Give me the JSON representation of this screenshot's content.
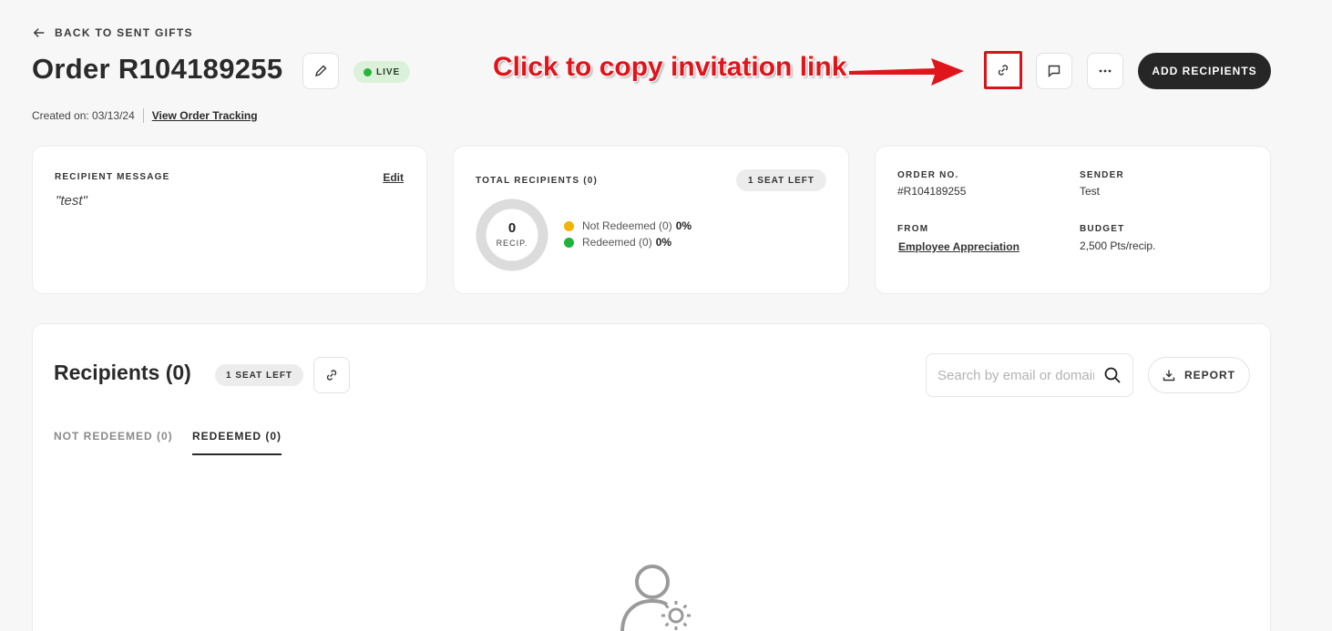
{
  "nav": {
    "back_label": "BACK TO SENT GIFTS"
  },
  "order": {
    "title": "Order R104189255",
    "status": "LIVE",
    "created_on": "Created on: 03/13/24",
    "tracking_link": "View Order Tracking"
  },
  "annotation": {
    "text": "Click to copy invitation link"
  },
  "toolbar": {
    "add_recipients_label": "ADD RECIPIENTS"
  },
  "message_card": {
    "label": "RECIPIENT MESSAGE",
    "edit_label": "Edit",
    "message": "\"test\""
  },
  "recipients_card": {
    "label": "TOTAL RECIPIENTS (0)",
    "seats": "1 SEAT LEFT",
    "count": "0",
    "unit": "RECIP.",
    "legend": [
      {
        "label": "Not Redeemed (0)",
        "pct": "0%",
        "color": "#f0b400"
      },
      {
        "label": "Redeemed (0)",
        "pct": "0%",
        "color": "#1fb33a"
      }
    ]
  },
  "info_card": {
    "order_no_label": "ORDER NO.",
    "order_no": "#R104189255",
    "sender_label": "SENDER",
    "sender": "Test",
    "from_label": "FROM",
    "from": "Employee Appreciation",
    "budget_label": "BUDGET",
    "budget": "2,500 Pts/recip."
  },
  "recipients_panel": {
    "title": "Recipients (0)",
    "seats": "1 SEAT LEFT",
    "search_placeholder": "Search by email or domain",
    "report_label": "REPORT",
    "tabs": [
      {
        "label": "NOT REDEEMED (0)",
        "active": false
      },
      {
        "label": "REDEEMED (0)",
        "active": true
      }
    ]
  },
  "colors": {
    "accent_dark": "#262626",
    "live_green": "#25b53a",
    "annotation_red": "#e0141b"
  }
}
